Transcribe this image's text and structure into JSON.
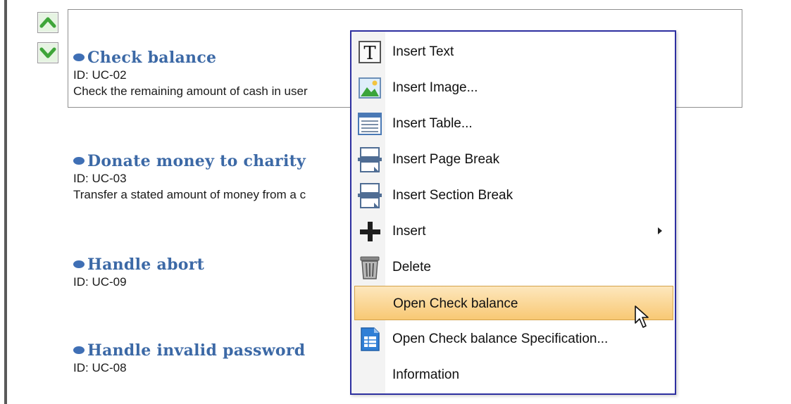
{
  "nav": {
    "up_icon": "chevron-up-icon",
    "down_icon": "chevron-down-icon"
  },
  "use_cases": [
    {
      "title": "Check balance",
      "id": "ID: UC-02",
      "description": "Check the remaining amount of cash in user"
    },
    {
      "title": "Donate money to charity",
      "id": "ID: UC-03",
      "description": "Transfer a stated amount of money from a c"
    },
    {
      "title": "Handle abort",
      "id": "ID: UC-09",
      "description": ""
    },
    {
      "title": "Handle invalid password",
      "id": "ID: UC-08",
      "description": ""
    }
  ],
  "context_menu": {
    "items": [
      {
        "label": "Insert Text",
        "icon": "text-icon"
      },
      {
        "label": "Insert Image...",
        "icon": "image-icon"
      },
      {
        "label": "Insert Table...",
        "icon": "table-icon"
      },
      {
        "label": "Insert Page Break",
        "icon": "page-break-icon"
      },
      {
        "label": "Insert Section Break",
        "icon": "section-break-icon"
      },
      {
        "label": "Insert",
        "icon": "plus-icon",
        "has_submenu": true
      },
      {
        "label": "Delete",
        "icon": "trash-icon"
      },
      {
        "label": "Open Check balance",
        "icon": "",
        "highlighted": true
      },
      {
        "label": "Open Check balance Specification...",
        "icon": "specification-icon"
      },
      {
        "label": "Information",
        "icon": ""
      }
    ]
  },
  "colors": {
    "title_blue": "#3c69a6",
    "menu_border": "#2d2fa0",
    "highlight": "#f8c874",
    "arrow_green": "#3fa53a"
  }
}
